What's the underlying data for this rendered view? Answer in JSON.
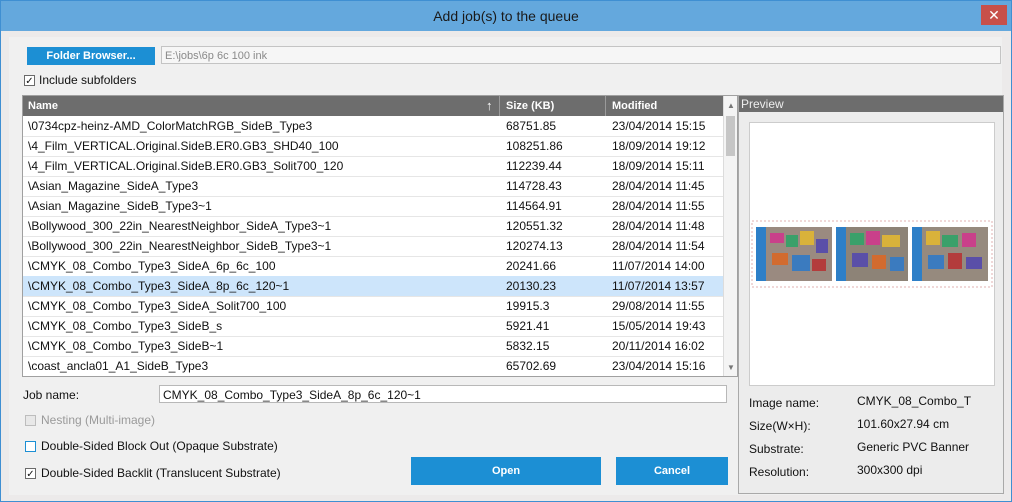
{
  "window": {
    "title": "Add job(s) to the queue",
    "close_glyph": "✕"
  },
  "folder": {
    "button_label": "Folder Browser...",
    "path": "E:\\jobs\\6p 6c 100 ink"
  },
  "include_subfolders": {
    "label": "Include subfolders",
    "checked": true
  },
  "table": {
    "headers": {
      "name": "Name",
      "size": "Size (KB)",
      "modified": "Modified",
      "sort_glyph": "↑"
    },
    "rows": [
      {
        "name": "\\0734cpz-heinz-AMD_ColorMatchRGB_SideB_Type3",
        "size": "68751.85",
        "modified": "23/04/2014 15:15"
      },
      {
        "name": "\\4_Film_VERTICAL.Original.SideB.ER0.GB3_SHD40_100",
        "size": "108251.86",
        "modified": "18/09/2014 19:12"
      },
      {
        "name": "\\4_Film_VERTICAL.Original.SideB.ER0.GB3_Solit700_120",
        "size": "112239.44",
        "modified": "18/09/2014 15:11"
      },
      {
        "name": "\\Asian_Magazine_SideA_Type3",
        "size": "114728.43",
        "modified": "28/04/2014 11:45"
      },
      {
        "name": "\\Asian_Magazine_SideB_Type3~1",
        "size": "114564.91",
        "modified": "28/04/2014 11:55"
      },
      {
        "name": "\\Bollywood_300_22in_NearestNeighbor_SideA_Type3~1",
        "size": "120551.32",
        "modified": "28/04/2014 11:48"
      },
      {
        "name": "\\Bollywood_300_22in_NearestNeighbor_SideB_Type3~1",
        "size": "120274.13",
        "modified": "28/04/2014 11:54"
      },
      {
        "name": "\\CMYK_08_Combo_Type3_SideA_6p_6c_100",
        "size": "20241.66",
        "modified": "11/07/2014 14:00"
      },
      {
        "name": "\\CMYK_08_Combo_Type3_SideA_8p_6c_120~1",
        "size": "20130.23",
        "modified": "11/07/2014 13:57"
      },
      {
        "name": "\\CMYK_08_Combo_Type3_SideA_Solit700_100",
        "size": "19915.3",
        "modified": "29/08/2014 11:55"
      },
      {
        "name": "\\CMYK_08_Combo_Type3_SideB_s",
        "size": "5921.41",
        "modified": "15/05/2014 19:43"
      },
      {
        "name": "\\CMYK_08_Combo_Type3_SideB~1",
        "size": "5832.15",
        "modified": "20/11/2014 16:02"
      },
      {
        "name": "\\coast_ancla01_A1_SideB_Type3",
        "size": "65702.69",
        "modified": "23/04/2014 15:16"
      }
    ],
    "selected_index": 8
  },
  "job": {
    "label": "Job name:",
    "value": "CMYK_08_Combo_Type3_SideA_8p_6c_120~1"
  },
  "options": {
    "nesting": {
      "label": "Nesting (Multi-image)",
      "checked": false,
      "disabled": true
    },
    "blockout": {
      "label": "Double-Sided Block Out (Opaque Substrate)",
      "checked": false
    },
    "backlit": {
      "label": "Double-Sided Backlit (Translucent Substrate)",
      "checked": true
    }
  },
  "buttons": {
    "open": "Open",
    "cancel": "Cancel"
  },
  "preview": {
    "title": "Preview",
    "info": [
      {
        "label": "Image name:",
        "value": "CMYK_08_Combo_T"
      },
      {
        "label": "Size(W×H):",
        "value": "101.60x27.94 cm"
      },
      {
        "label": "Substrate:",
        "value": "Generic PVC Banner"
      },
      {
        "label": "Resolution:",
        "value": "300x300 dpi"
      }
    ]
  },
  "colors": {
    "titlebar": "#64a8dd",
    "accent": "#1c8fd4",
    "header": "#6d6d6d",
    "selection": "#cde5fb"
  }
}
